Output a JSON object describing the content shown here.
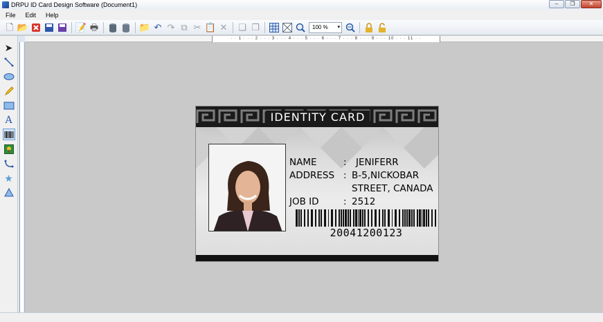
{
  "window": {
    "title": "DRPU ID Card Design Software  (Document1)"
  },
  "menu": {
    "file": "File",
    "edit": "Edit",
    "help": "Help"
  },
  "toolbar": {
    "zoom": "100 %"
  },
  "ruler": {
    "marks": "· · 1 · · · 2 · · · 3 · · · 4 · · · 5 · · · 6 · · · 7 · · · 8 · · · 9 · · · 10 · · · 11 · ·"
  },
  "card": {
    "title": "IDENTITY CARD",
    "name_label": "NAME",
    "name_value": "JENIFERR",
    "address_label": "ADDRESS",
    "address_value_1": "B-5,NICKOBAR",
    "address_value_2": "STREET, CANADA",
    "jobid_label": "JOB ID",
    "jobid_value": "2512",
    "colon": ":",
    "barcode_number": "20041200123"
  },
  "colors": {
    "card_header": "#1a1a1a",
    "accent": "#2b5aa8"
  }
}
